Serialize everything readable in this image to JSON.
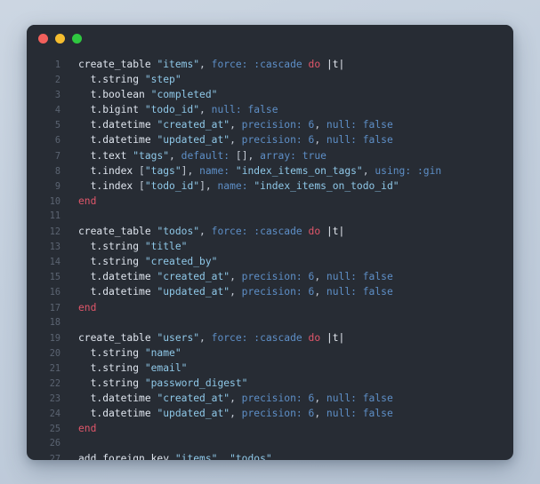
{
  "window": {
    "traffic_lights": [
      {
        "name": "close-button",
        "color": "#f2605c",
        "label": "close"
      },
      {
        "name": "minimize-button",
        "color": "#f5bd2f",
        "label": "minimize"
      },
      {
        "name": "maximize-button",
        "color": "#2fc840",
        "label": "maximize"
      }
    ]
  },
  "editor": {
    "language": "ruby",
    "theme": "dark",
    "background": "#272c34",
    "page_background": "#c3cfdd",
    "first_line_number": 1,
    "last_line_number": 27,
    "total_lines": 27,
    "colors": {
      "plain": "#d8dee8",
      "string": "#8fc8e8",
      "symbol": "#5e8fc7",
      "keyword": "#e0566a",
      "number": "#5e8fc7",
      "gutter": "#5b6472"
    },
    "lines": [
      {
        "number": "1",
        "text": "create_table \"items\", force: :cascade do |t|",
        "tokens": [
          {
            "t": "create_table",
            "c": "method"
          },
          {
            "t": " ",
            "c": "plain"
          },
          {
            "t": "\"items\"",
            "c": "string"
          },
          {
            "t": ", ",
            "c": "punct"
          },
          {
            "t": "force:",
            "c": "key"
          },
          {
            "t": " ",
            "c": "plain"
          },
          {
            "t": ":cascade",
            "c": "symbol"
          },
          {
            "t": " ",
            "c": "plain"
          },
          {
            "t": "do",
            "c": "keyword"
          },
          {
            "t": " ",
            "c": "plain"
          },
          {
            "t": "|t|",
            "c": "block"
          }
        ]
      },
      {
        "number": "2",
        "text": "  t.string \"step\"",
        "tokens": [
          {
            "t": "  t.string",
            "c": "method"
          },
          {
            "t": " ",
            "c": "plain"
          },
          {
            "t": "\"step\"",
            "c": "string"
          }
        ]
      },
      {
        "number": "3",
        "text": "  t.boolean \"completed\"",
        "tokens": [
          {
            "t": "  t.boolean",
            "c": "method"
          },
          {
            "t": " ",
            "c": "plain"
          },
          {
            "t": "\"completed\"",
            "c": "string"
          }
        ]
      },
      {
        "number": "4",
        "text": "  t.bigint \"todo_id\", null: false",
        "tokens": [
          {
            "t": "  t.bigint",
            "c": "method"
          },
          {
            "t": " ",
            "c": "plain"
          },
          {
            "t": "\"todo_id\"",
            "c": "string"
          },
          {
            "t": ", ",
            "c": "punct"
          },
          {
            "t": "null:",
            "c": "key"
          },
          {
            "t": " ",
            "c": "plain"
          },
          {
            "t": "false",
            "c": "const"
          }
        ]
      },
      {
        "number": "5",
        "text": "  t.datetime \"created_at\", precision: 6, null: false",
        "tokens": [
          {
            "t": "  t.datetime",
            "c": "method"
          },
          {
            "t": " ",
            "c": "plain"
          },
          {
            "t": "\"created_at\"",
            "c": "string"
          },
          {
            "t": ", ",
            "c": "punct"
          },
          {
            "t": "precision:",
            "c": "key"
          },
          {
            "t": " ",
            "c": "plain"
          },
          {
            "t": "6",
            "c": "number"
          },
          {
            "t": ", ",
            "c": "punct"
          },
          {
            "t": "null:",
            "c": "key"
          },
          {
            "t": " ",
            "c": "plain"
          },
          {
            "t": "false",
            "c": "const"
          }
        ]
      },
      {
        "number": "6",
        "text": "  t.datetime \"updated_at\", precision: 6, null: false",
        "tokens": [
          {
            "t": "  t.datetime",
            "c": "method"
          },
          {
            "t": " ",
            "c": "plain"
          },
          {
            "t": "\"updated_at\"",
            "c": "string"
          },
          {
            "t": ", ",
            "c": "punct"
          },
          {
            "t": "precision:",
            "c": "key"
          },
          {
            "t": " ",
            "c": "plain"
          },
          {
            "t": "6",
            "c": "number"
          },
          {
            "t": ", ",
            "c": "punct"
          },
          {
            "t": "null:",
            "c": "key"
          },
          {
            "t": " ",
            "c": "plain"
          },
          {
            "t": "false",
            "c": "const"
          }
        ]
      },
      {
        "number": "7",
        "text": "  t.text \"tags\", default: [], array: true",
        "tokens": [
          {
            "t": "  t.text",
            "c": "method"
          },
          {
            "t": " ",
            "c": "plain"
          },
          {
            "t": "\"tags\"",
            "c": "string"
          },
          {
            "t": ", ",
            "c": "punct"
          },
          {
            "t": "default:",
            "c": "key"
          },
          {
            "t": " ",
            "c": "plain"
          },
          {
            "t": "[]",
            "c": "punct"
          },
          {
            "t": ", ",
            "c": "punct"
          },
          {
            "t": "array:",
            "c": "key"
          },
          {
            "t": " ",
            "c": "plain"
          },
          {
            "t": "true",
            "c": "const"
          }
        ]
      },
      {
        "number": "8",
        "text": "  t.index [\"tags\"], name: \"index_items_on_tags\", using: :gin",
        "tokens": [
          {
            "t": "  t.index",
            "c": "method"
          },
          {
            "t": " ",
            "c": "plain"
          },
          {
            "t": "[",
            "c": "punct"
          },
          {
            "t": "\"tags\"",
            "c": "string"
          },
          {
            "t": "]",
            "c": "punct"
          },
          {
            "t": ", ",
            "c": "punct"
          },
          {
            "t": "name:",
            "c": "key"
          },
          {
            "t": " ",
            "c": "plain"
          },
          {
            "t": "\"index_items_on_tags\"",
            "c": "string"
          },
          {
            "t": ", ",
            "c": "punct"
          },
          {
            "t": "using:",
            "c": "key"
          },
          {
            "t": " ",
            "c": "plain"
          },
          {
            "t": ":gin",
            "c": "symbol"
          }
        ]
      },
      {
        "number": "9",
        "text": "  t.index [\"todo_id\"], name: \"index_items_on_todo_id\"",
        "tokens": [
          {
            "t": "  t.index",
            "c": "method"
          },
          {
            "t": " ",
            "c": "plain"
          },
          {
            "t": "[",
            "c": "punct"
          },
          {
            "t": "\"todo_id\"",
            "c": "string"
          },
          {
            "t": "]",
            "c": "punct"
          },
          {
            "t": ", ",
            "c": "punct"
          },
          {
            "t": "name:",
            "c": "key"
          },
          {
            "t": " ",
            "c": "plain"
          },
          {
            "t": "\"index_items_on_todo_id\"",
            "c": "string"
          }
        ]
      },
      {
        "number": "10",
        "text": "end",
        "tokens": [
          {
            "t": "end",
            "c": "keyword"
          }
        ]
      },
      {
        "number": "11",
        "text": "",
        "tokens": []
      },
      {
        "number": "12",
        "text": "create_table \"todos\", force: :cascade do |t|",
        "tokens": [
          {
            "t": "create_table",
            "c": "method"
          },
          {
            "t": " ",
            "c": "plain"
          },
          {
            "t": "\"todos\"",
            "c": "string"
          },
          {
            "t": ", ",
            "c": "punct"
          },
          {
            "t": "force:",
            "c": "key"
          },
          {
            "t": " ",
            "c": "plain"
          },
          {
            "t": ":cascade",
            "c": "symbol"
          },
          {
            "t": " ",
            "c": "plain"
          },
          {
            "t": "do",
            "c": "keyword"
          },
          {
            "t": " ",
            "c": "plain"
          },
          {
            "t": "|t|",
            "c": "block"
          }
        ]
      },
      {
        "number": "13",
        "text": "  t.string \"title\"",
        "tokens": [
          {
            "t": "  t.string",
            "c": "method"
          },
          {
            "t": " ",
            "c": "plain"
          },
          {
            "t": "\"title\"",
            "c": "string"
          }
        ]
      },
      {
        "number": "14",
        "text": "  t.string \"created_by\"",
        "tokens": [
          {
            "t": "  t.string",
            "c": "method"
          },
          {
            "t": " ",
            "c": "plain"
          },
          {
            "t": "\"created_by\"",
            "c": "string"
          }
        ]
      },
      {
        "number": "15",
        "text": "  t.datetime \"created_at\", precision: 6, null: false",
        "tokens": [
          {
            "t": "  t.datetime",
            "c": "method"
          },
          {
            "t": " ",
            "c": "plain"
          },
          {
            "t": "\"created_at\"",
            "c": "string"
          },
          {
            "t": ", ",
            "c": "punct"
          },
          {
            "t": "precision:",
            "c": "key"
          },
          {
            "t": " ",
            "c": "plain"
          },
          {
            "t": "6",
            "c": "number"
          },
          {
            "t": ", ",
            "c": "punct"
          },
          {
            "t": "null:",
            "c": "key"
          },
          {
            "t": " ",
            "c": "plain"
          },
          {
            "t": "false",
            "c": "const"
          }
        ]
      },
      {
        "number": "16",
        "text": "  t.datetime \"updated_at\", precision: 6, null: false",
        "tokens": [
          {
            "t": "  t.datetime",
            "c": "method"
          },
          {
            "t": " ",
            "c": "plain"
          },
          {
            "t": "\"updated_at\"",
            "c": "string"
          },
          {
            "t": ", ",
            "c": "punct"
          },
          {
            "t": "precision:",
            "c": "key"
          },
          {
            "t": " ",
            "c": "plain"
          },
          {
            "t": "6",
            "c": "number"
          },
          {
            "t": ", ",
            "c": "punct"
          },
          {
            "t": "null:",
            "c": "key"
          },
          {
            "t": " ",
            "c": "plain"
          },
          {
            "t": "false",
            "c": "const"
          }
        ]
      },
      {
        "number": "17",
        "text": "end",
        "tokens": [
          {
            "t": "end",
            "c": "keyword"
          }
        ]
      },
      {
        "number": "18",
        "text": "",
        "tokens": []
      },
      {
        "number": "19",
        "text": "create_table \"users\", force: :cascade do |t|",
        "tokens": [
          {
            "t": "create_table",
            "c": "method"
          },
          {
            "t": " ",
            "c": "plain"
          },
          {
            "t": "\"users\"",
            "c": "string"
          },
          {
            "t": ", ",
            "c": "punct"
          },
          {
            "t": "force:",
            "c": "key"
          },
          {
            "t": " ",
            "c": "plain"
          },
          {
            "t": ":cascade",
            "c": "symbol"
          },
          {
            "t": " ",
            "c": "plain"
          },
          {
            "t": "do",
            "c": "keyword"
          },
          {
            "t": " ",
            "c": "plain"
          },
          {
            "t": "|t|",
            "c": "block"
          }
        ]
      },
      {
        "number": "20",
        "text": "  t.string \"name\"",
        "tokens": [
          {
            "t": "  t.string",
            "c": "method"
          },
          {
            "t": " ",
            "c": "plain"
          },
          {
            "t": "\"name\"",
            "c": "string"
          }
        ]
      },
      {
        "number": "21",
        "text": "  t.string \"email\"",
        "tokens": [
          {
            "t": "  t.string",
            "c": "method"
          },
          {
            "t": " ",
            "c": "plain"
          },
          {
            "t": "\"email\"",
            "c": "string"
          }
        ]
      },
      {
        "number": "22",
        "text": "  t.string \"password_digest\"",
        "tokens": [
          {
            "t": "  t.string",
            "c": "method"
          },
          {
            "t": " ",
            "c": "plain"
          },
          {
            "t": "\"password_digest\"",
            "c": "string"
          }
        ]
      },
      {
        "number": "23",
        "text": "  t.datetime \"created_at\", precision: 6, null: false",
        "tokens": [
          {
            "t": "  t.datetime",
            "c": "method"
          },
          {
            "t": " ",
            "c": "plain"
          },
          {
            "t": "\"created_at\"",
            "c": "string"
          },
          {
            "t": ", ",
            "c": "punct"
          },
          {
            "t": "precision:",
            "c": "key"
          },
          {
            "t": " ",
            "c": "plain"
          },
          {
            "t": "6",
            "c": "number"
          },
          {
            "t": ", ",
            "c": "punct"
          },
          {
            "t": "null:",
            "c": "key"
          },
          {
            "t": " ",
            "c": "plain"
          },
          {
            "t": "false",
            "c": "const"
          }
        ]
      },
      {
        "number": "24",
        "text": "  t.datetime \"updated_at\", precision: 6, null: false",
        "tokens": [
          {
            "t": "  t.datetime",
            "c": "method"
          },
          {
            "t": " ",
            "c": "plain"
          },
          {
            "t": "\"updated_at\"",
            "c": "string"
          },
          {
            "t": ", ",
            "c": "punct"
          },
          {
            "t": "precision:",
            "c": "key"
          },
          {
            "t": " ",
            "c": "plain"
          },
          {
            "t": "6",
            "c": "number"
          },
          {
            "t": ", ",
            "c": "punct"
          },
          {
            "t": "null:",
            "c": "key"
          },
          {
            "t": " ",
            "c": "plain"
          },
          {
            "t": "false",
            "c": "const"
          }
        ]
      },
      {
        "number": "25",
        "text": "end",
        "tokens": [
          {
            "t": "end",
            "c": "keyword"
          }
        ]
      },
      {
        "number": "26",
        "text": "",
        "tokens": []
      },
      {
        "number": "27",
        "text": "add_foreign_key \"items\", \"todos\"",
        "tokens": [
          {
            "t": "add_foreign_key",
            "c": "method"
          },
          {
            "t": " ",
            "c": "plain"
          },
          {
            "t": "\"items\"",
            "c": "string"
          },
          {
            "t": ", ",
            "c": "punct"
          },
          {
            "t": "\"todos\"",
            "c": "string"
          }
        ]
      }
    ]
  }
}
